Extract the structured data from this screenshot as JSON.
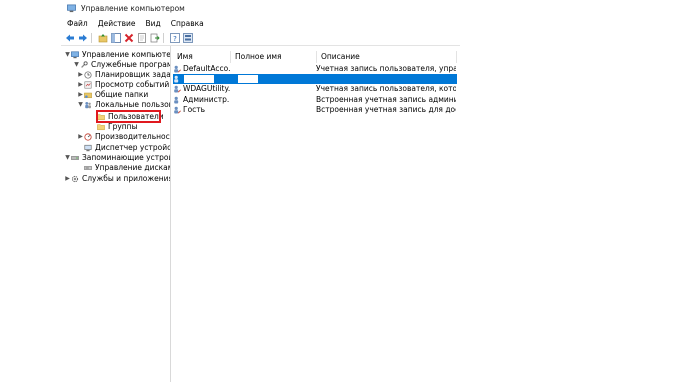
{
  "window": {
    "title": "Управление компьютером"
  },
  "menu": [
    "Файл",
    "Действие",
    "Вид",
    "Справка"
  ],
  "toolbar": [
    "back-icon",
    "forward-icon",
    "up-folder-icon",
    "show-hide-tree-icon",
    "delete-icon",
    "properties-icon",
    "export-icon",
    "help-icon",
    "view-icon"
  ],
  "tree": {
    "root": "Управление компьютером (л",
    "service_tools": "Служебные программы",
    "task_scheduler": "Планировщик задач",
    "event_viewer": "Просмотр событий",
    "shared_folders": "Общие папки",
    "local_users": "Локальные пользоват",
    "users": "Пользователи",
    "groups": "Группы",
    "performance": "Производительность",
    "device_manager": "Диспетчер устройств",
    "storage": "Запоминающие устройст",
    "disk_management": "Управление дисками",
    "services_apps": "Службы и приложения"
  },
  "columns": {
    "name": "Имя",
    "full_name": "Полное имя",
    "description": "Описание"
  },
  "rows": [
    {
      "name": "DefaultAcco...",
      "full_name": "",
      "description": "Учетная запись пользователя, управляе..."
    },
    {
      "name": "",
      "full_name": "",
      "description": "",
      "selected": true
    },
    {
      "name": "WDAGUtility...",
      "full_name": "",
      "description": "Учетная запись пользователя, которая ..."
    },
    {
      "name": "Администр...",
      "full_name": "",
      "description": "Встроенная учетная запись администра..."
    },
    {
      "name": "Гость",
      "full_name": "",
      "description": "Встроенная учетная запись для доступа ..."
    }
  ],
  "colors": {
    "selection": "#0078d7",
    "highlight_frame": "#e0191f"
  }
}
